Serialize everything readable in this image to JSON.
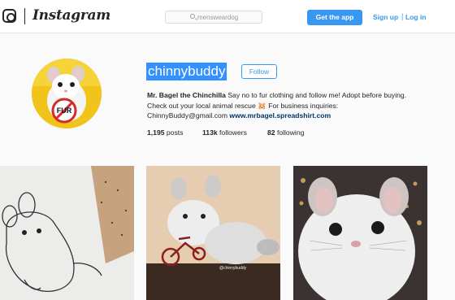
{
  "nav": {
    "logo_icon": "instagram-camera-icon",
    "wordmark": "Instagram",
    "search": {
      "value": "mensweardog",
      "icon": "search-icon"
    },
    "get_app": "Get the app",
    "sign_up": "Sign up",
    "separator": "|",
    "log_in": "Log in"
  },
  "profile": {
    "username": "chinnybuddy",
    "follow": "Follow",
    "avatar_sign_text": "FUR",
    "bio": {
      "name": "Mr. Bagel the Chinchilla",
      "text": " Say no to fur clothing and follow me! Adopt before buying. Check out your local animal rescue 🐹 For business inquiries: ChinnyBuddy@gmail.com ",
      "link": "www.mrbagel.spreadshirt.com"
    },
    "stats": {
      "posts_count": "1,195",
      "posts_label": " posts",
      "followers_count": "113k",
      "followers_label": " followers",
      "following_count": "82",
      "following_label": " following"
    }
  },
  "posts": [
    {
      "kind": "sketch of a chinchilla"
    },
    {
      "kind": "chinchilla on a toy bicycle",
      "watermark": "@chinnybuddy"
    },
    {
      "kind": "close-up chinchilla portrait"
    }
  ],
  "colors": {
    "accent": "#3897f0",
    "selection": "#3390ff",
    "link": "#003569",
    "avatar_bg": "#f0c419"
  }
}
